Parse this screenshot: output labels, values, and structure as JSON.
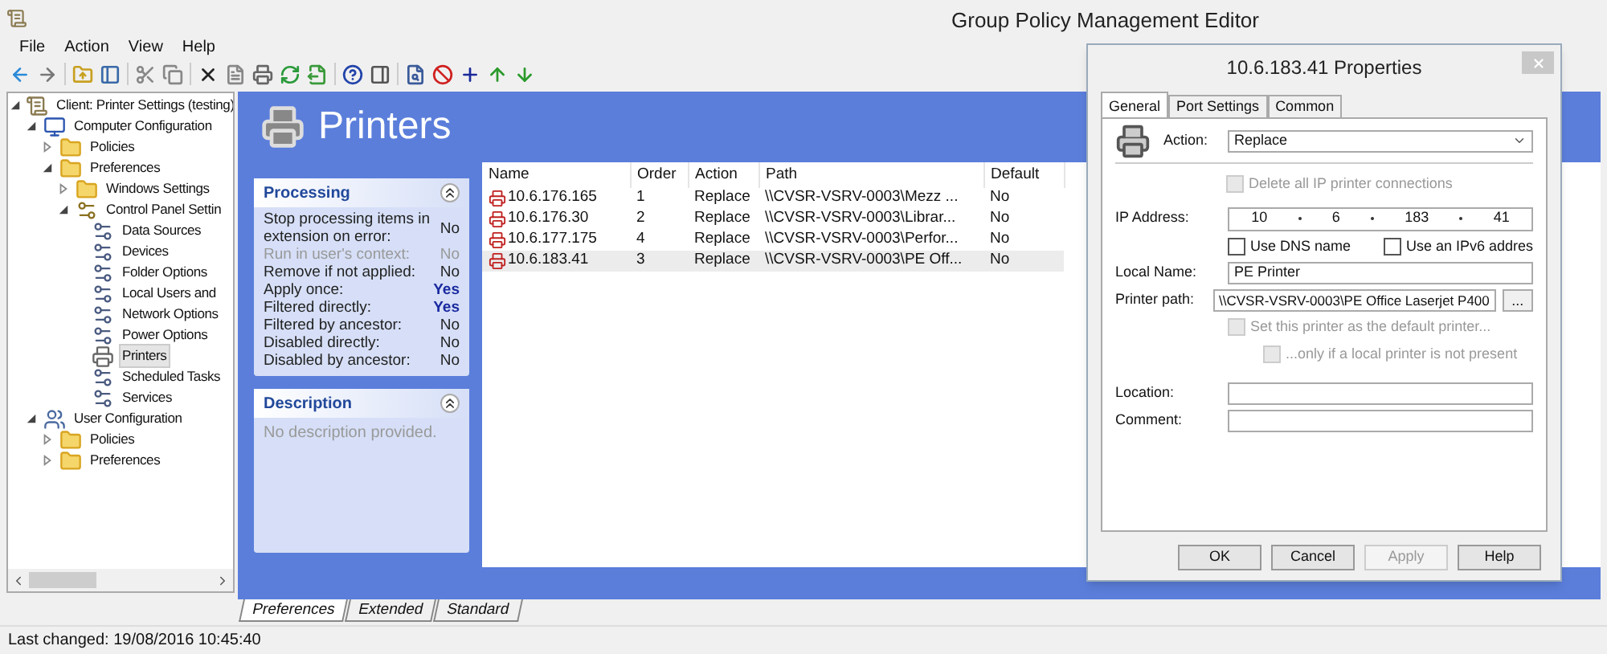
{
  "window": {
    "title": "Group Policy Management Editor"
  },
  "menu": [
    "File",
    "Action",
    "View",
    "Help"
  ],
  "tree": [
    {
      "label": "Client: Printer Settings (testing)",
      "expanded": true,
      "selected": false,
      "children": [
        {
          "label": "Computer Configuration",
          "expanded": true,
          "selected": false,
          "children": [
            {
              "label": "Policies",
              "expanded": false,
              "selected": false
            },
            {
              "label": "Preferences",
              "expanded": true,
              "selected": false,
              "children": [
                {
                  "label": "Windows Settings",
                  "expanded": false,
                  "selected": false
                },
                {
                  "label": "Control Panel Settin",
                  "expanded": true,
                  "selected": false,
                  "children": [
                    {
                      "label": "Data Sources",
                      "selected": false
                    },
                    {
                      "label": "Devices",
                      "selected": false
                    },
                    {
                      "label": "Folder Options",
                      "selected": false
                    },
                    {
                      "label": "Local Users and",
                      "selected": false
                    },
                    {
                      "label": "Network Options",
                      "selected": false
                    },
                    {
                      "label": "Power Options",
                      "selected": false
                    },
                    {
                      "label": "Printers",
                      "selected": true
                    },
                    {
                      "label": "Scheduled Tasks",
                      "selected": false
                    },
                    {
                      "label": "Services",
                      "selected": false
                    }
                  ]
                }
              ]
            }
          ]
        },
        {
          "label": "User Configuration",
          "expanded": true,
          "selected": false,
          "children": [
            {
              "label": "Policies",
              "expanded": false,
              "selected": false
            },
            {
              "label": "Preferences",
              "expanded": false,
              "selected": false
            }
          ]
        }
      ]
    }
  ],
  "header": {
    "title": "Printers"
  },
  "processing": {
    "title": "Processing",
    "rows": [
      {
        "label": "Stop processing items in extension on error:",
        "value": "No",
        "disabled": false,
        "highlighted": false
      },
      {
        "label": "Run in user's context:",
        "value": "No",
        "disabled": true,
        "highlighted": false
      },
      {
        "label": "Remove if not applied:",
        "value": "No",
        "disabled": false,
        "highlighted": false
      },
      {
        "label": "Apply once:",
        "value": "Yes",
        "disabled": false,
        "highlighted": true
      },
      {
        "label": "Filtered directly:",
        "value": "Yes",
        "disabled": false,
        "highlighted": true
      },
      {
        "label": "Filtered by ancestor:",
        "value": "No",
        "disabled": false,
        "highlighted": false
      },
      {
        "label": "Disabled directly:",
        "value": "No",
        "disabled": false,
        "highlighted": false
      },
      {
        "label": "Disabled by ancestor:",
        "value": "No",
        "disabled": false,
        "highlighted": false
      }
    ]
  },
  "description": {
    "title": "Description",
    "text": "No description provided."
  },
  "table": {
    "columns": [
      "Name",
      "Order",
      "Action",
      "Path",
      "Default"
    ],
    "rows": [
      {
        "cells": [
          "10.6.176.165",
          "1",
          "Replace",
          "\\\\CVSR-VSRV-0003\\Mezz ...",
          "No"
        ],
        "selected": false
      },
      {
        "cells": [
          "10.6.176.30",
          "2",
          "Replace",
          "\\\\CVSR-VSRV-0003\\Librar...",
          "No"
        ],
        "selected": false
      },
      {
        "cells": [
          "10.6.177.175",
          "4",
          "Replace",
          "\\\\CVSR-VSRV-0003\\Perfor...",
          "No"
        ],
        "selected": false
      },
      {
        "cells": [
          "10.6.183.41",
          "3",
          "Replace",
          "\\\\CVSR-VSRV-0003\\PE Off...",
          "No"
        ],
        "selected": true
      }
    ]
  },
  "bottom_tabs": [
    {
      "label": "Preferences",
      "selected": true
    },
    {
      "label": "Extended",
      "selected": false
    },
    {
      "label": "Standard",
      "selected": false
    }
  ],
  "status_bar": "Last changed: 19/08/2016 10:45:40",
  "dialog": {
    "title": "10.6.183.41 Properties",
    "tabs": [
      {
        "label": "General",
        "selected": true
      },
      {
        "label": "Port Settings",
        "selected": false
      },
      {
        "label": "Common",
        "selected": false
      }
    ],
    "action": {
      "label": "Action:",
      "value": "Replace"
    },
    "delete_all": {
      "label": "Delete all IP printer connections",
      "checked": false,
      "disabled": true
    },
    "ip": {
      "label": "IP Address:",
      "octets": [
        "10",
        "6",
        "183",
        "41"
      ]
    },
    "use_dns": {
      "label": "Use DNS name",
      "checked": false,
      "disabled": false
    },
    "use_ipv6": {
      "label": "Use an IPv6 addres",
      "checked": false,
      "disabled": false
    },
    "local_name": {
      "label": "Local Name:",
      "value": "PE Printer"
    },
    "printer_path": {
      "label": "Printer path:",
      "value": "\\\\CVSR-VSRV-0003\\PE Office Laserjet P400",
      "browse": "..."
    },
    "set_default": {
      "label": "Set this printer as the default printer...",
      "checked": false,
      "disabled": true
    },
    "only_if": {
      "label": "...only if a local printer is not present",
      "checked": false,
      "disabled": true
    },
    "location": {
      "label": "Location:"
    },
    "comment": {
      "label": "Comment:"
    },
    "buttons": [
      {
        "label": "OK",
        "disabled": false
      },
      {
        "label": "Cancel",
        "disabled": false
      },
      {
        "label": "Apply",
        "disabled": true
      },
      {
        "label": "Help",
        "disabled": false
      }
    ]
  }
}
